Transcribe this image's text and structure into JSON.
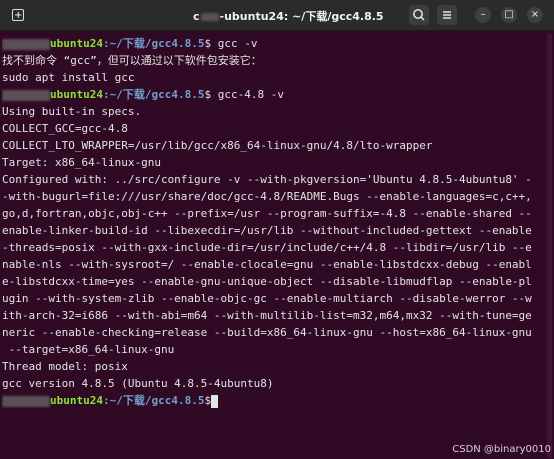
{
  "window": {
    "title_masked": "c",
    "title_visible": "-ubuntu24: ~/下载/gcc4.8.5",
    "buttons": {
      "search_icon": "search-icon",
      "menu_icon": "menu-icon",
      "minimize": "–",
      "maximize": "□",
      "close": "×"
    }
  },
  "prompt": {
    "user": "ubuntu24",
    "path": ":~/下载/gcc4.8.5",
    "dollar": "$"
  },
  "lines": [
    {
      "kind": "prompt",
      "cmd": " gcc -v"
    },
    {
      "kind": "text",
      "text": "找不到命令 “gcc”，但可以通过以下软件包安装它："
    },
    {
      "kind": "text",
      "text": "sudo apt install gcc"
    },
    {
      "kind": "prompt",
      "cmd": " gcc-4.8 -v"
    },
    {
      "kind": "text",
      "text": "Using built-in specs."
    },
    {
      "kind": "text",
      "text": "COLLECT_GCC=gcc-4.8"
    },
    {
      "kind": "text",
      "text": "COLLECT_LTO_WRAPPER=/usr/lib/gcc/x86_64-linux-gnu/4.8/lto-wrapper"
    },
    {
      "kind": "text",
      "text": "Target: x86_64-linux-gnu"
    },
    {
      "kind": "text",
      "text": "Configured with: ../src/configure -v --with-pkgversion='Ubuntu 4.8.5-4ubuntu8' -"
    },
    {
      "kind": "text",
      "text": "-with-bugurl=file:///usr/share/doc/gcc-4.8/README.Bugs --enable-languages=c,c++,"
    },
    {
      "kind": "text",
      "text": "go,d,fortran,objc,obj-c++ --prefix=/usr --program-suffix=-4.8 --enable-shared --"
    },
    {
      "kind": "text",
      "text": "enable-linker-build-id --libexecdir=/usr/lib --without-included-gettext --enable"
    },
    {
      "kind": "text",
      "text": "-threads=posix --with-gxx-include-dir=/usr/include/c++/4.8 --libdir=/usr/lib --e"
    },
    {
      "kind": "text",
      "text": "nable-nls --with-sysroot=/ --enable-clocale=gnu --enable-libstdcxx-debug --enabl"
    },
    {
      "kind": "text",
      "text": "e-libstdcxx-time=yes --enable-gnu-unique-object --disable-libmudflap --enable-pl"
    },
    {
      "kind": "text",
      "text": "ugin --with-system-zlib --enable-objc-gc --enable-multiarch --disable-werror --w"
    },
    {
      "kind": "text",
      "text": "ith-arch-32=i686 --with-abi=m64 --with-multilib-list=m32,m64,mx32 --with-tune=ge"
    },
    {
      "kind": "text",
      "text": "neric --enable-checking=release --build=x86_64-linux-gnu --host=x86_64-linux-gnu"
    },
    {
      "kind": "text",
      "text": " --target=x86_64-linux-gnu"
    },
    {
      "kind": "text",
      "text": "Thread model: posix"
    },
    {
      "kind": "text",
      "text": "gcc version 4.8.5 (Ubuntu 4.8.5-4ubuntu8)"
    },
    {
      "kind": "prompt",
      "cmd": ""
    }
  ],
  "watermark": "CSDN @binary0010"
}
